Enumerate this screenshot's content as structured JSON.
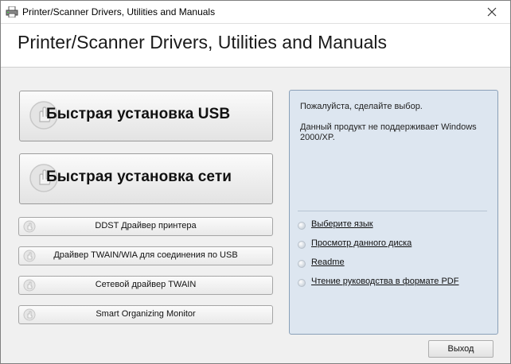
{
  "window": {
    "title": "Printer/Scanner Drivers, Utilities and Manuals"
  },
  "header": {
    "title": "Printer/Scanner Drivers, Utilities and Manuals"
  },
  "buttons": {
    "usb_install": "Быстрая установка USB",
    "network_install": "Быстрая установка сети",
    "ddst_driver": "DDST Драйвер принтера",
    "twain_usb": "Драйвер TWAIN/WIA для соединения по USB",
    "network_twain": "Сетевой драйвер TWAIN",
    "smart_monitor": "Smart Organizing Monitor",
    "exit": "Выход"
  },
  "info_panel": {
    "prompt": "Пожалуйста, сделайте выбор.",
    "unsupported": "Данный продукт не поддерживает Windows 2000/XP.",
    "links": [
      "Выберите язык",
      "Просмотр данного диска",
      "Readme",
      "Чтение руководства в формате PDF"
    ]
  },
  "icons": {
    "app": "printer-app-icon",
    "close": "close-icon",
    "button": "cursor-hand-icon",
    "bullet": "bullet-icon"
  },
  "colors": {
    "panel_bg": "#dde6f0",
    "panel_border": "#8aa0b8",
    "window_bg": "#f0f0f0"
  }
}
